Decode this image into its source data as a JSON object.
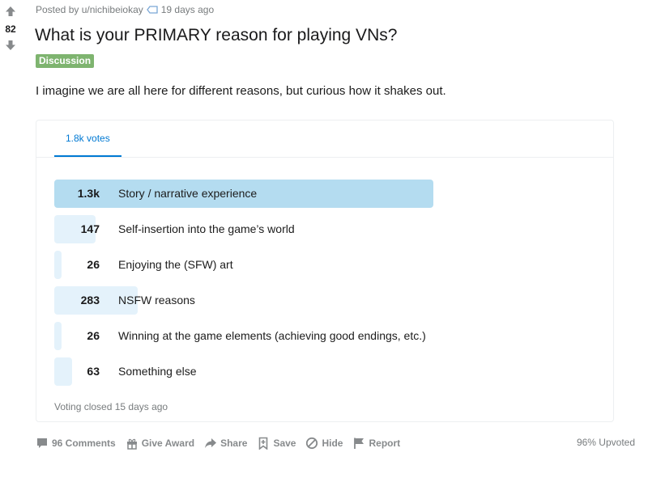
{
  "vote": {
    "score": "82"
  },
  "meta": {
    "posted_by": "Posted by u/nichibeiokay",
    "time": "19 days ago"
  },
  "post": {
    "title": "What is your PRIMARY reason for playing VNs?",
    "flair": "Discussion",
    "body": "I imagine we are all here for different reasons, but curious how it shakes out."
  },
  "poll": {
    "tab_label": "1.8k votes",
    "options": [
      {
        "count": "1.3k",
        "label": "Story / narrative experience",
        "share": 0.73
      },
      {
        "count": "147",
        "label": "Self-insertion into the game’s world",
        "share": 0.08
      },
      {
        "count": "26",
        "label": "Enjoying the (SFW) art",
        "share": 0.014
      },
      {
        "count": "283",
        "label": "NSFW reasons",
        "share": 0.16
      },
      {
        "count": "26",
        "label": "Winning at the game elements (achieving good endings, etc.)",
        "share": 0.014
      },
      {
        "count": "63",
        "label": "Something else",
        "share": 0.035
      }
    ],
    "status": "Voting closed 15 days ago"
  },
  "actions": {
    "comments": "96 Comments",
    "award": "Give Award",
    "share": "Share",
    "save": "Save",
    "hide": "Hide",
    "report": "Report"
  },
  "upvoted": "96% Upvoted",
  "colors": {
    "accent": "#0079d3",
    "flair": "#7eb46f",
    "bar": "#e4f2fb",
    "bar_winner": "#b4dcf0",
    "muted": "#878a8c"
  }
}
